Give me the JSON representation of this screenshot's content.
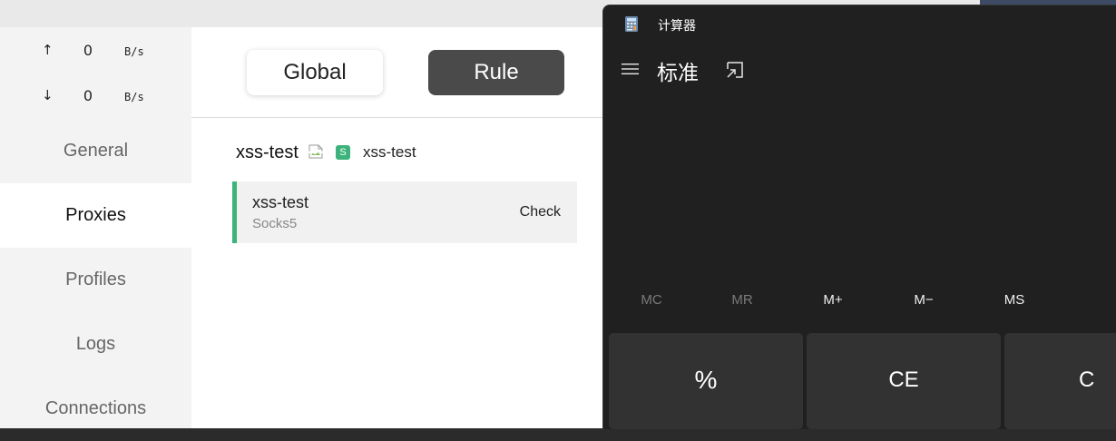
{
  "clash": {
    "traffic": {
      "up": {
        "arrow": "↑",
        "value": "0",
        "unit": "B/s"
      },
      "down": {
        "arrow": "↓",
        "value": "0",
        "unit": "B/s"
      }
    },
    "nav": {
      "general": "General",
      "proxies": "Proxies",
      "profiles": "Profiles",
      "logs": "Logs",
      "connections": "Connections"
    },
    "modes": {
      "global": "Global",
      "rule": "Rule"
    },
    "group": {
      "name": "xss-test",
      "badge": "S",
      "selected": "xss-test"
    },
    "proxy": {
      "name": "xss-test",
      "type": "Socks5",
      "check": "Check"
    }
  },
  "calculator": {
    "window_title": "计算器",
    "mode": "标准",
    "memory": [
      "MC",
      "MR",
      "M+",
      "M−",
      "MS"
    ],
    "keys": {
      "percent": "%",
      "ce": "CE",
      "c": "C"
    }
  },
  "colors": {
    "accent_green": "#3bb37a",
    "calc_bg": "#202020",
    "calc_key": "#323232",
    "rule_active": "#4a4a4a"
  }
}
